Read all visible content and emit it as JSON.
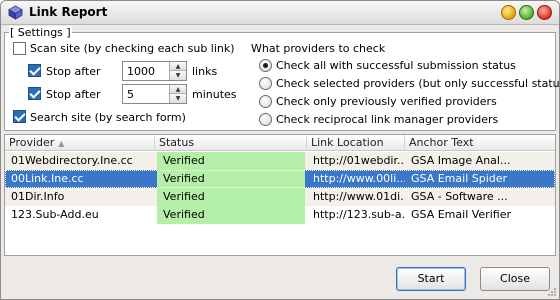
{
  "window": {
    "title": "Link Report"
  },
  "settings": {
    "legend": "[ Settings ]",
    "scan_site": {
      "label": "Scan site (by checking each sub link)",
      "checked": false
    },
    "stop_after_links": {
      "label": "Stop after",
      "value": "1000",
      "unit": "links",
      "checked": true
    },
    "stop_after_minutes": {
      "label": "Stop after",
      "value": "5",
      "unit": "minutes",
      "checked": true
    },
    "search_site": {
      "label": "Search site (by search form)",
      "checked": true
    },
    "providers_heading": "What providers to check",
    "provider_options": [
      {
        "label": "Check all with successful submission status",
        "selected": true
      },
      {
        "label": "Check selected providers (but only successful status)",
        "selected": false
      },
      {
        "label": "Check only previously verified providers",
        "selected": false
      },
      {
        "label": "Check reciprocal link manager providers",
        "selected": false
      }
    ]
  },
  "table": {
    "columns": [
      "Provider",
      "Status",
      "Link Location",
      "Anchor Text"
    ],
    "rows": [
      {
        "provider": "01Webdirectory.Ine.cc",
        "status": "Verified",
        "link": "http://01webdir...",
        "anchor": "GSA Image Anal..."
      },
      {
        "provider": "00Link.Ine.cc",
        "status": "Verified",
        "link": "http://www.00li...",
        "anchor": "GSA Email Spider"
      },
      {
        "provider": "01Dir.Info",
        "status": "Verified",
        "link": "http://www.01di...",
        "anchor": "GSA - Software ..."
      },
      {
        "provider": "123.Sub-Add.eu",
        "status": "Verified",
        "link": "http://123.sub-a...",
        "anchor": "GSA Email Verifier"
      }
    ],
    "selected_row": 1
  },
  "buttons": {
    "start": "Start",
    "close": "Close"
  },
  "colors": {
    "status_verified": "#b4f0a8",
    "selection": "#3a77c9",
    "checkbox_checked": "#2a6fb8"
  }
}
